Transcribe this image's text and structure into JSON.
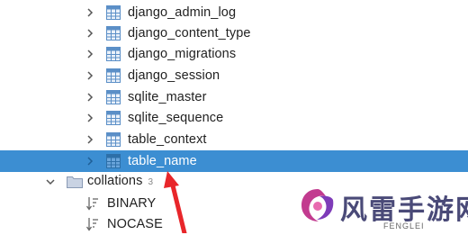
{
  "tree": {
    "tables": [
      {
        "name": "django_admin_log"
      },
      {
        "name": "django_content_type"
      },
      {
        "name": "django_migrations"
      },
      {
        "name": "django_session"
      },
      {
        "name": "sqlite_master"
      },
      {
        "name": "sqlite_sequence"
      },
      {
        "name": "table_context"
      },
      {
        "name": "table_name",
        "selected": true
      }
    ],
    "collations": {
      "label": "collations",
      "count": "3",
      "items": [
        {
          "name": "BINARY"
        },
        {
          "name": "NOCASE"
        }
      ]
    }
  },
  "watermark": {
    "text": "风雷手游网",
    "sub": "FENGLEI"
  },
  "colors": {
    "selection": "#3c8ed2",
    "annotation_arrow": "#e8262a",
    "table_icon": "#5b8fc7",
    "folder_icon": "#8a9ab5"
  }
}
